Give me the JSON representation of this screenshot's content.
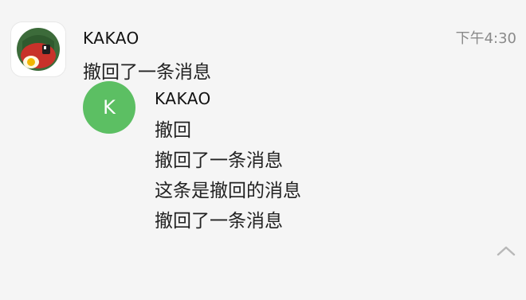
{
  "notification": {
    "sender": "KAKAO",
    "time": "下午4:30",
    "preview": "撤回了一条消息",
    "app_icon": "kakao-app-icon",
    "nested_message": {
      "avatar_letter": "K",
      "avatar_color": "#5cbf63",
      "sender": "KAKAO",
      "lines": [
        "撤回",
        "撤回了一条消息",
        "这条是撤回的消息",
        "撤回了一条消息"
      ]
    },
    "collapse_icon": "chevron-up-icon"
  },
  "colors": {
    "background": "#f5f5f5",
    "time_text": "#8a8a8a",
    "avatar": "#5cbf63"
  }
}
